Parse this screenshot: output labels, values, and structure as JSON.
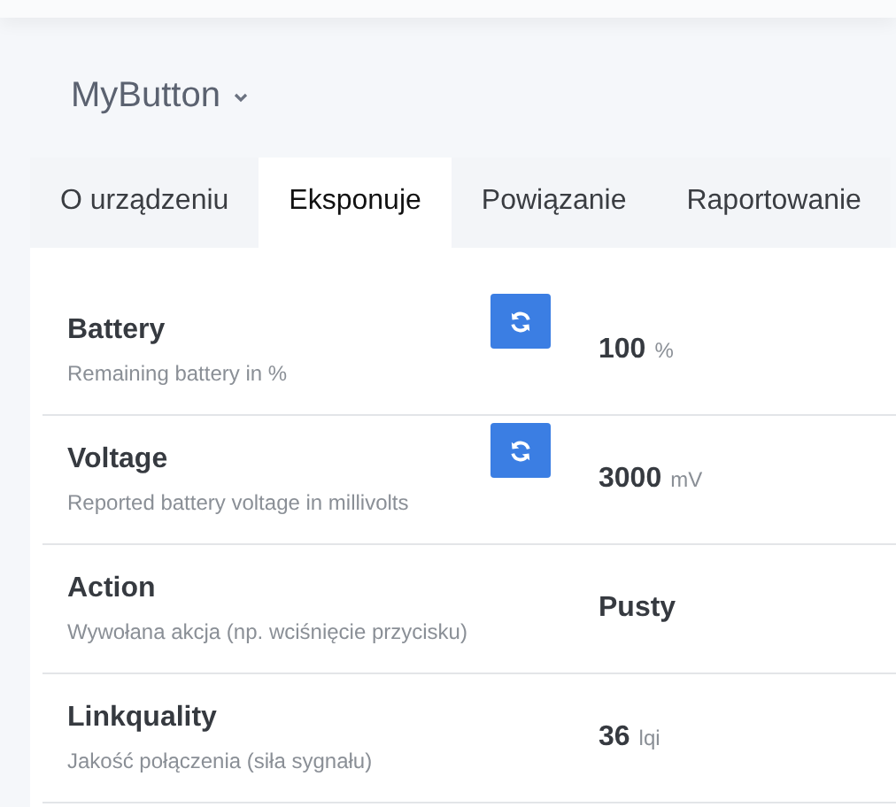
{
  "device": {
    "name": "MyButton"
  },
  "tabs": [
    {
      "label": "O urządzeniu",
      "selected": false
    },
    {
      "label": "Eksponuje",
      "selected": true
    },
    {
      "label": "Powiązanie",
      "selected": false
    },
    {
      "label": "Raportowanie",
      "selected": false
    }
  ],
  "exposes": [
    {
      "name": "Battery",
      "description": "Remaining battery in %",
      "value": "100",
      "unit": "%",
      "refreshable": true
    },
    {
      "name": "Voltage",
      "description": "Reported battery voltage in millivolts",
      "value": "3000",
      "unit": "mV",
      "refreshable": true
    },
    {
      "name": "Action",
      "description": "Wywołana akcja (np. wciśnięcie przycisku)",
      "value": "Pusty",
      "refreshable": false
    },
    {
      "name": "Linkquality",
      "description": "Jakość połączenia (siła sygnału)",
      "value": "36",
      "unit": "lqi",
      "refreshable": false
    }
  ]
}
